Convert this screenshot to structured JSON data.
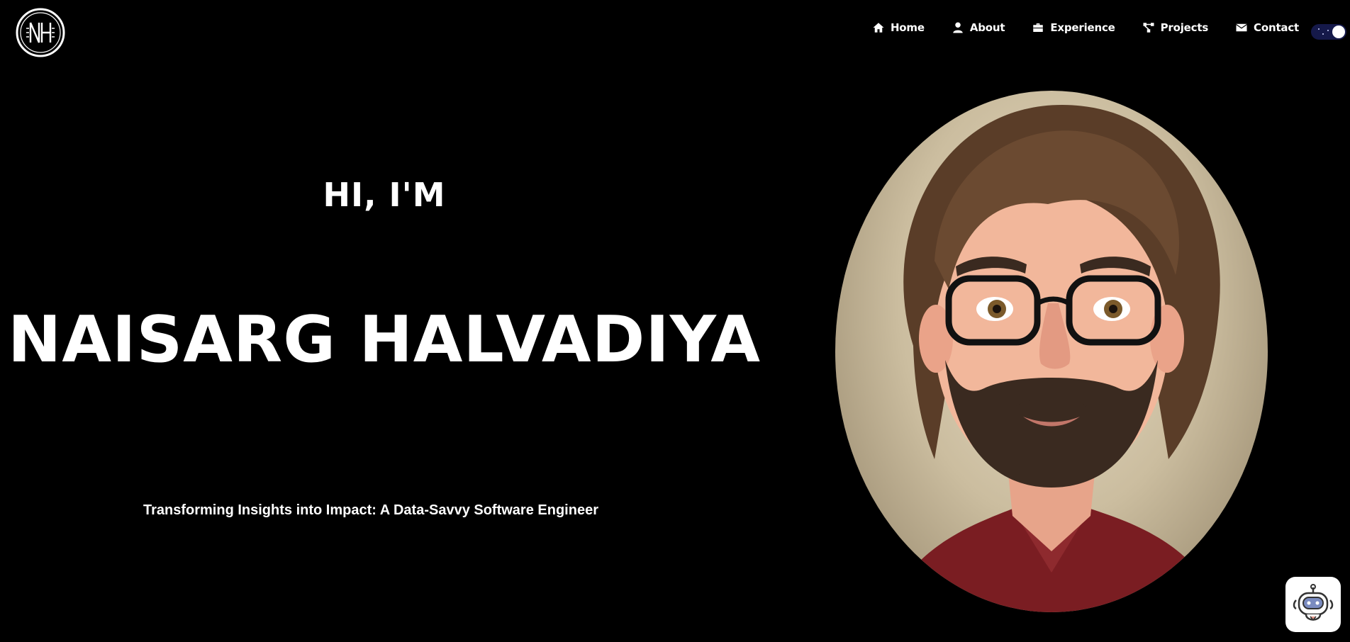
{
  "header": {
    "logo_alt": "NH",
    "nav": [
      {
        "label": "Home",
        "icon": "home-icon"
      },
      {
        "label": "About",
        "icon": "user-icon"
      },
      {
        "label": "Experience",
        "icon": "briefcase-icon"
      },
      {
        "label": "Projects",
        "icon": "share-nodes-icon"
      },
      {
        "label": "Contact",
        "icon": "envelope-icon"
      }
    ],
    "theme_toggle": {
      "state": "dark"
    }
  },
  "hero": {
    "greeting": "HI, I'M",
    "name": "NAISARG HALVADIYA",
    "tagline": "Transforming Insights into Impact: A Data-Savvy Software Engineer"
  },
  "colors": {
    "background": "#000000",
    "text": "#ffffff",
    "toggle_track": "#15194a"
  }
}
